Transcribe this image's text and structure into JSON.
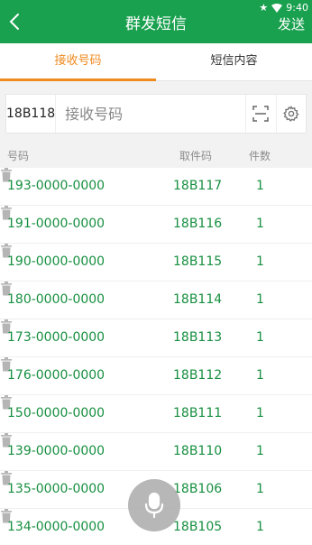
{
  "status": {
    "time": "9:40"
  },
  "appbar": {
    "title": "群发短信",
    "send_label": "发送"
  },
  "tabs": [
    {
      "label": "接收号码",
      "active": true
    },
    {
      "label": "短信内容",
      "active": false
    }
  ],
  "input": {
    "prefix": "18B118",
    "placeholder": "接收号码"
  },
  "header": {
    "number": "号码",
    "code": "取件码",
    "count": "件数"
  },
  "rows": [
    {
      "number": "193-0000-0000",
      "code": "18B117",
      "count": "1"
    },
    {
      "number": "191-0000-0000",
      "code": "18B116",
      "count": "1"
    },
    {
      "number": "190-0000-0000",
      "code": "18B115",
      "count": "1"
    },
    {
      "number": "180-0000-0000",
      "code": "18B114",
      "count": "1"
    },
    {
      "number": "173-0000-0000",
      "code": "18B113",
      "count": "1"
    },
    {
      "number": "176-0000-0000",
      "code": "18B112",
      "count": "1"
    },
    {
      "number": "150-0000-0000",
      "code": "18B111",
      "count": "1"
    },
    {
      "number": "139-0000-0000",
      "code": "18B110",
      "count": "1"
    },
    {
      "number": "135-0000-0000",
      "code": "18B106",
      "count": "1"
    },
    {
      "number": "134-0000-0000",
      "code": "18B105",
      "count": "1"
    }
  ],
  "icons": {
    "back": "chevron-left-icon",
    "scan": "scan-icon",
    "settings": "gear-icon",
    "delete": "trash-icon",
    "mic": "microphone-icon"
  },
  "colors": {
    "primary": "#1aa14f",
    "accent": "#ef8a1e",
    "number_text": "#178f40"
  }
}
